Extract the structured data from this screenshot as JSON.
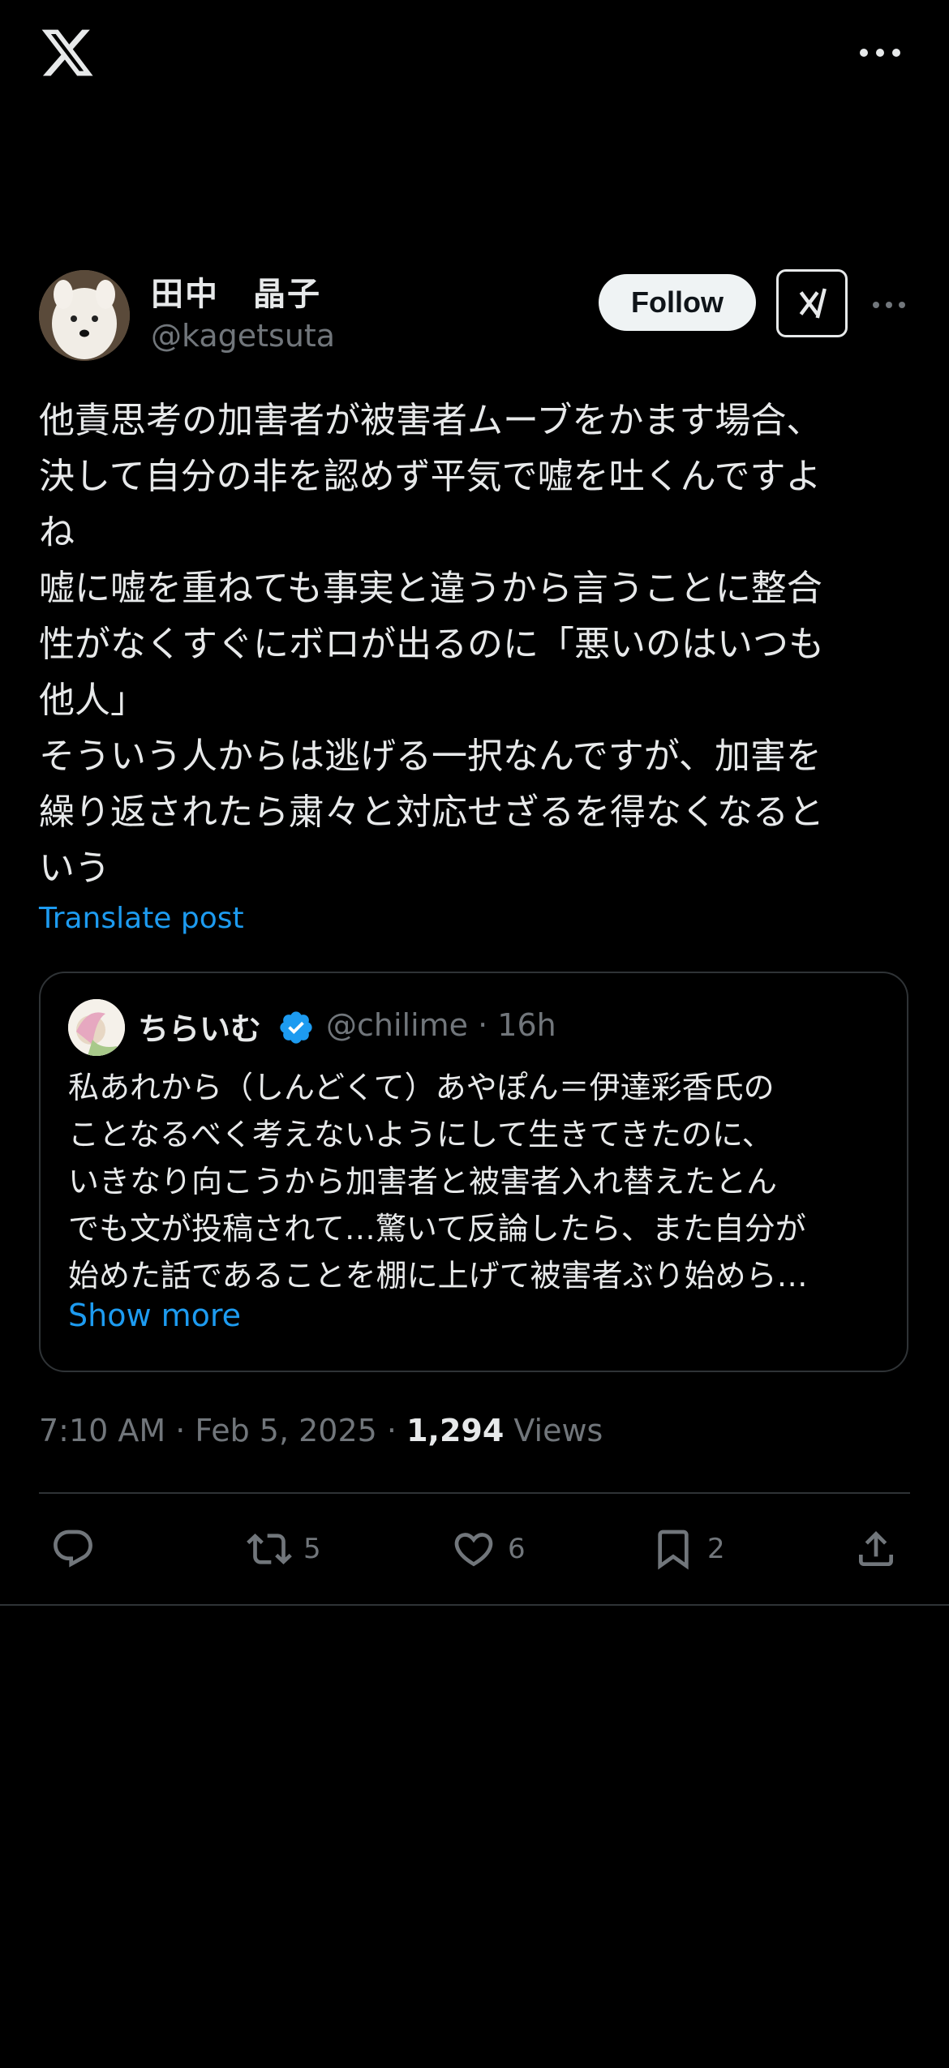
{
  "author": {
    "display_name": "田中　晶子",
    "handle": "@kagetsuta"
  },
  "follow_label": "Follow",
  "post": {
    "text": "他責思考の加害者が被害者ムーブをかます場合、\n決して自分の非を認めず平気で嘘を吐くんですよ\nね\n嘘に嘘を重ねても事実と違うから言うことに整合\n性がなくすぐにボロが出るのに「悪いのはいつも\n他人」\nそういう人からは逃げる一択なんですが、加害を\n繰り返されたら粛々と対応せざるを得なくなると\nいう",
    "translate_label": "Translate post"
  },
  "quote": {
    "display_name": "ちらいむ",
    "handle_time": "@chilime · 16h",
    "text": "私あれから（しんどくて）あやぽん＝伊達彩香氏の\nことなるべく考えないようにして生きてきたのに、\nいきなり向こうから加害者と被害者入れ替えたとん\nでも文が投稿されて…驚いて反論したら、また自分が\n始めた話であることを棚に上げて被害者ぶり始めら…",
    "show_more_label": "Show more"
  },
  "meta": {
    "datetime": "7:10 AM · Feb 5, 2025 · ",
    "views_count": "1,294",
    "views_label": " Views"
  },
  "actions": {
    "reposts": "5",
    "likes": "6",
    "bookmarks": "2"
  },
  "colors": {
    "background": "#000000",
    "accent": "#1d9bf0",
    "muted": "#71767b",
    "text": "#e7e9ea"
  }
}
